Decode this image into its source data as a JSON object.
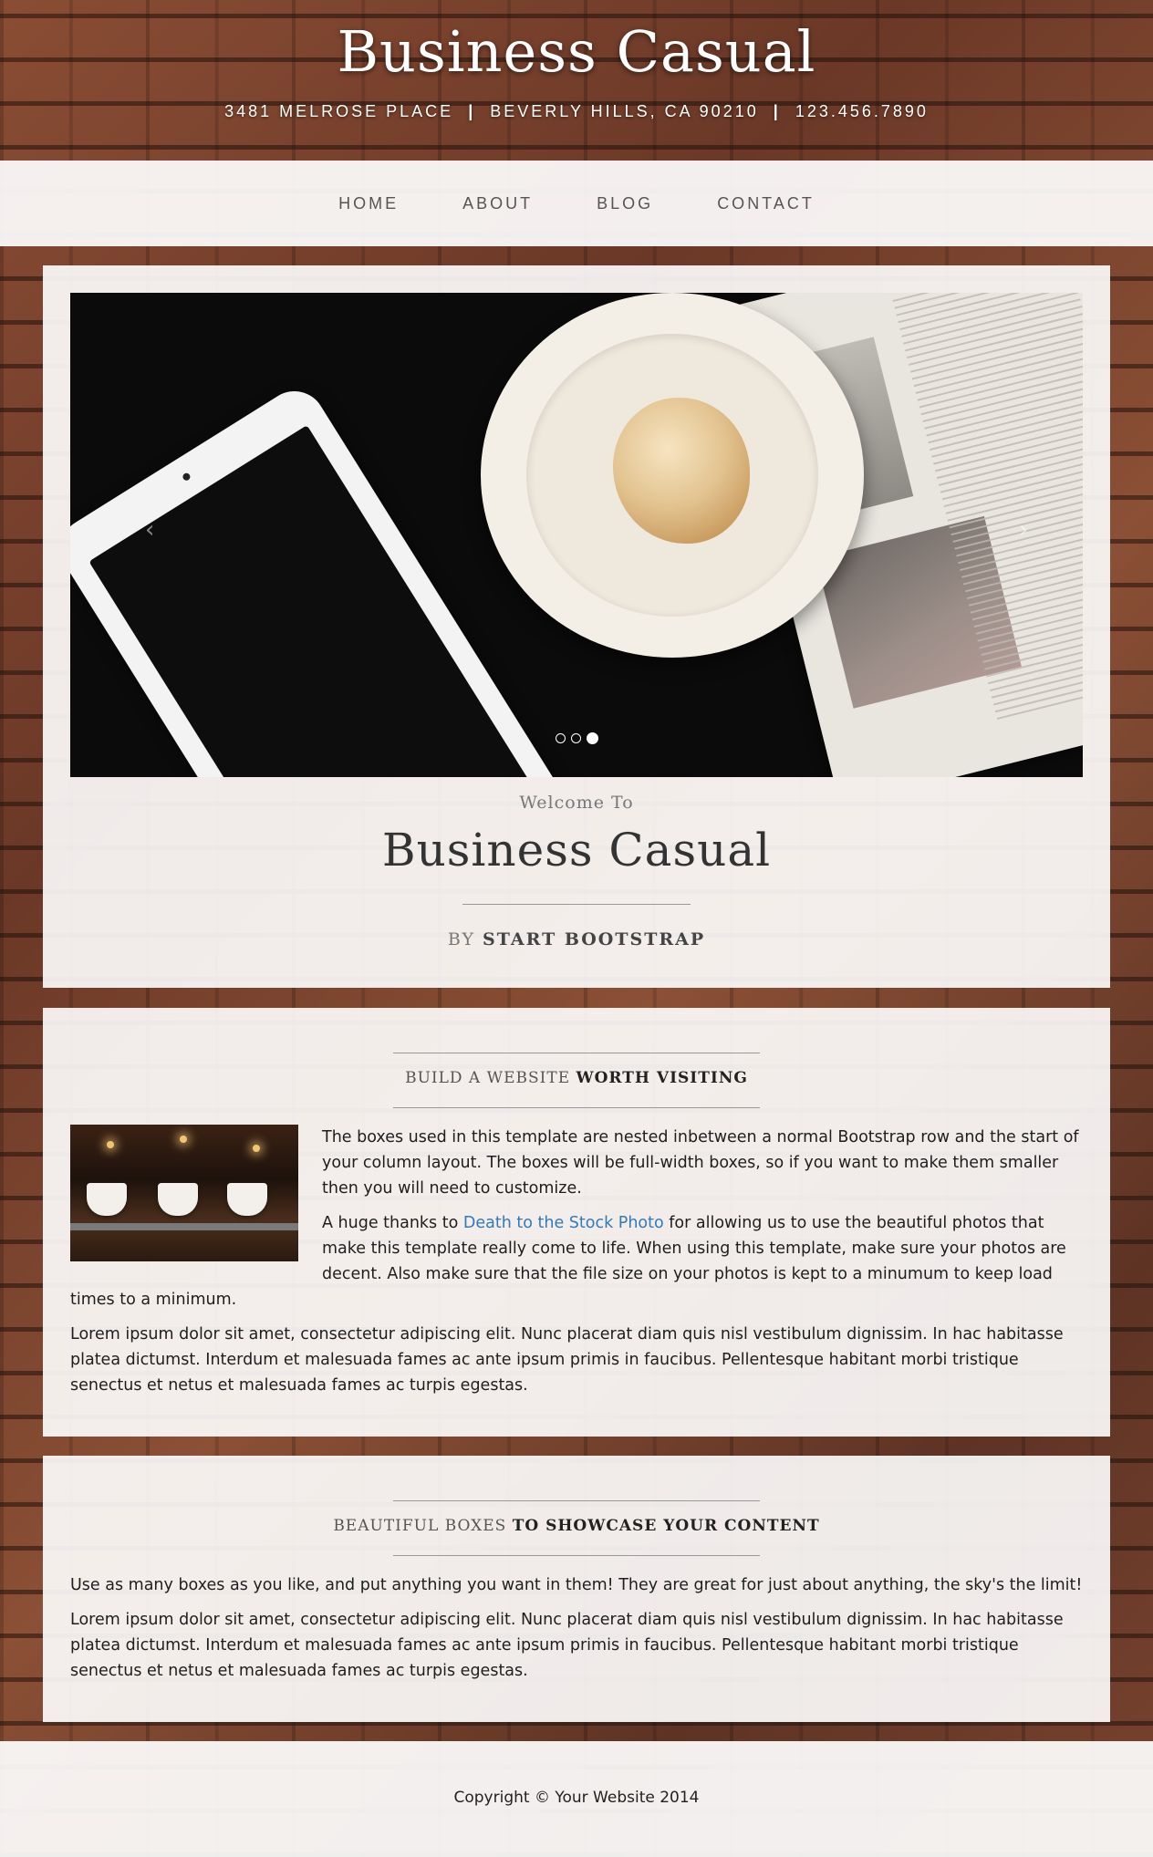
{
  "site": {
    "brand": "Business Casual",
    "address": {
      "street": "3481 MELROSE PLACE",
      "city": "BEVERLY HILLS, CA 90210",
      "phone": "123.456.7890",
      "separator": "|"
    }
  },
  "nav": {
    "items": [
      {
        "label": "HOME"
      },
      {
        "label": "ABOUT"
      },
      {
        "label": "BLOG"
      },
      {
        "label": "CONTACT"
      }
    ]
  },
  "carousel": {
    "slide_count": 3,
    "active_index": 2,
    "prev_icon": "chevron-left-icon",
    "next_icon": "chevron-right-icon",
    "prev_glyph": "‹",
    "next_glyph": "›"
  },
  "intro": {
    "welcome": "Welcome To",
    "title": "Business Casual",
    "byline_prefix": "BY",
    "byline_strong": "START BOOTSTRAP"
  },
  "section1": {
    "title_light": "Build a website",
    "title_strong": "worth visiting",
    "para1": "The boxes used in this template are nested inbetween a normal Bootstrap row and the start of your column layout. The boxes will be full-width boxes, so if you want to make them smaller then you will need to customize.",
    "para2_before": "A huge thanks to ",
    "para2_link": "Death to the Stock Photo",
    "para2_after": " for allowing us to use the beautiful photos that make this template really come to life. When using this template, make sure your photos are decent. Also make sure that the file size on your photos is kept to a minumum to keep load times to a minimum.",
    "para3": "Lorem ipsum dolor sit amet, consectetur adipiscing elit. Nunc placerat diam quis nisl vestibulum dignissim. In hac habitasse platea dictumst. Interdum et malesuada fames ac ante ipsum primis in faucibus. Pellentesque habitant morbi tristique senectus et netus et malesuada fames ac turpis egestas."
  },
  "section2": {
    "title_light": "Beautiful boxes",
    "title_strong": "to showcase your content",
    "para1": "Use as many boxes as you like, and put anything you want in them! They are great for just about anything, the sky's the limit!",
    "para2": "Lorem ipsum dolor sit amet, consectetur adipiscing elit. Nunc placerat diam quis nisl vestibulum dignissim. In hac habitasse platea dictumst. Interdum et malesuada fames ac ante ipsum primis in faucibus. Pellentesque habitant morbi tristique senectus et netus et malesuada fames ac turpis egestas."
  },
  "footer": {
    "copyright": "Copyright © Your Website 2014"
  },
  "colors": {
    "link": "#337ab7",
    "box_background": "#ffffff",
    "text": "#1e1e1e"
  }
}
